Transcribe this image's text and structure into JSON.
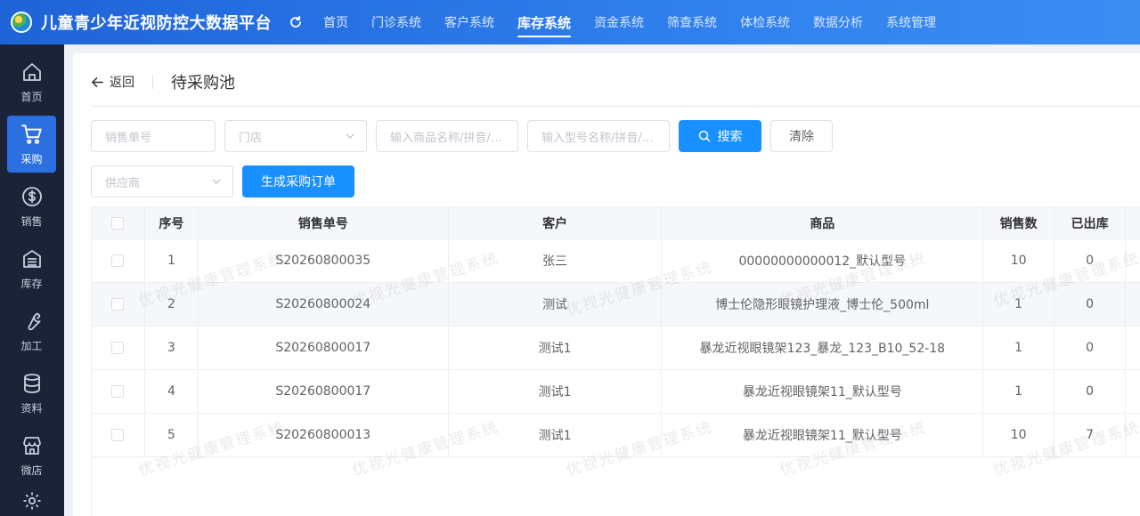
{
  "app": {
    "title": "儿童青少年近视防控大数据平台"
  },
  "nav": [
    {
      "label": "首页"
    },
    {
      "label": "门诊系统"
    },
    {
      "label": "客户系统"
    },
    {
      "label": "库存系统",
      "active": true
    },
    {
      "label": "资金系统"
    },
    {
      "label": "筛查系统"
    },
    {
      "label": "体检系统"
    },
    {
      "label": "数据分析"
    },
    {
      "label": "系统管理"
    }
  ],
  "sidebar": {
    "items": [
      {
        "label": "首页",
        "icon": "home-icon"
      },
      {
        "label": "采购",
        "icon": "cart-icon",
        "active": true
      },
      {
        "label": "销售",
        "icon": "dollar-icon"
      },
      {
        "label": "库存",
        "icon": "warehouse-icon"
      },
      {
        "label": "加工",
        "icon": "wrench-icon"
      },
      {
        "label": "资料",
        "icon": "database-icon"
      },
      {
        "label": "微店",
        "icon": "store-icon"
      }
    ]
  },
  "page": {
    "back_label": "返回",
    "title": "待采购池"
  },
  "filters": {
    "sales_no_placeholder": "销售单号",
    "store_placeholder": "门店",
    "product_placeholder": "输入商品名称/拼音/…",
    "model_placeholder": "输入型号名称/拼音/…",
    "supplier_placeholder": "供应商",
    "search_label": "搜索",
    "clear_label": "清除",
    "generate_label": "生成采购订单"
  },
  "table": {
    "headers": {
      "index": "序号",
      "sales_no": "销售单号",
      "customer": "客户",
      "product": "商品",
      "sold": "销售数",
      "outbound": "已出库"
    },
    "rows": [
      {
        "index": "1",
        "sales_no": "S20260800035",
        "customer": "张三",
        "product": "00000000000012_默认型号",
        "sold": "10",
        "outbound": "0"
      },
      {
        "index": "2",
        "sales_no": "S20260800024",
        "customer": "测试",
        "product": "博士伦隐形眼镜护理液_博士伦_500ml",
        "sold": "1",
        "outbound": "0"
      },
      {
        "index": "3",
        "sales_no": "S20260800017",
        "customer": "测试1",
        "product": "暴龙近视眼镜架123_暴龙_123_B10_52-18",
        "sold": "1",
        "outbound": "0"
      },
      {
        "index": "4",
        "sales_no": "S20260800017",
        "customer": "测试1",
        "product": "暴龙近视眼镜架11_默认型号",
        "sold": "1",
        "outbound": "0"
      },
      {
        "index": "5",
        "sales_no": "S20260800013",
        "customer": "测试1",
        "product": "暴龙近视眼镜架11_默认型号",
        "sold": "10",
        "outbound": "7"
      }
    ]
  },
  "watermark": "优视光健康管理系统",
  "colors": {
    "primary": "#1890ff",
    "topbar": "#2f80ed",
    "sidebar": "#1a2338",
    "sidebar_active": "#2b6fe0"
  }
}
